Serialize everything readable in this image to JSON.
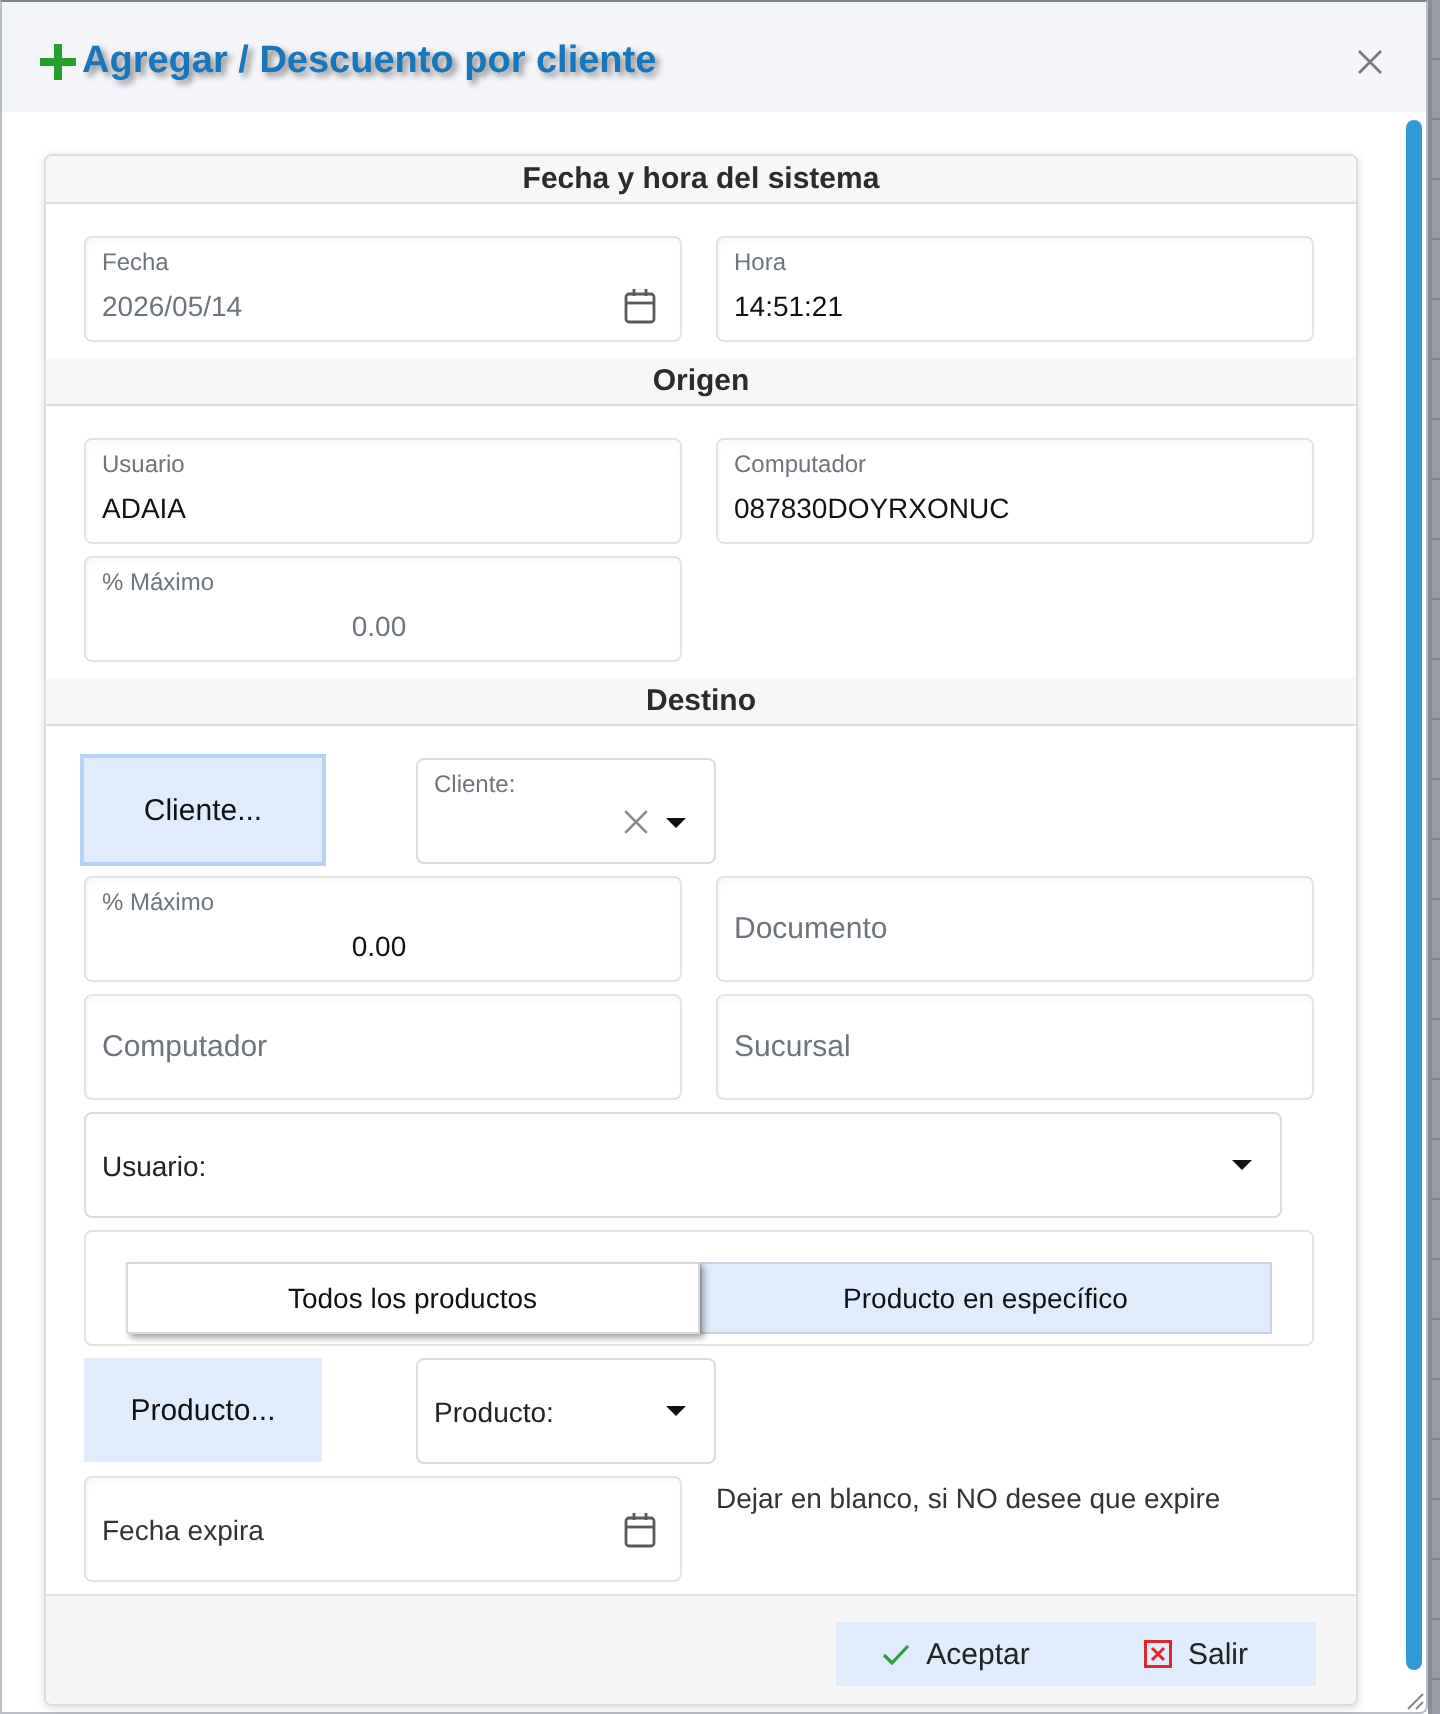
{
  "dialog": {
    "title": "Agregar / Descuento por cliente"
  },
  "sections": [
    {
      "title": "Fecha y hora del sistema",
      "items": [
        {
          "kind": "date",
          "label": "Fecha",
          "value": "2026/05/14",
          "disabled": true
        },
        {
          "kind": "text",
          "label": "Hora",
          "value": "14:51:21",
          "disabled": false
        }
      ]
    },
    {
      "title": "Origen",
      "items": [
        {
          "kind": "text",
          "label": "Usuario",
          "value": "ADAIA",
          "disabled": false
        },
        {
          "kind": "text",
          "label": "Computador",
          "value": "087830DOYRXONUC",
          "disabled": false
        },
        {
          "kind": "number",
          "label": "% Máximo",
          "value": "0.00",
          "disabled": true
        }
      ]
    },
    {
      "title": "Destino",
      "items": [
        {
          "kind": "lookup",
          "button": "Cliente...",
          "focused": true,
          "select": {
            "label": "Cliente:",
            "clearable": true
          }
        },
        {
          "kind": "number",
          "label": "% Máximo",
          "value": "0.00",
          "disabled": false
        },
        {
          "kind": "text",
          "placeholder": "Documento",
          "disabled": false
        },
        {
          "kind": "text",
          "placeholder": "Computador",
          "disabled": false
        },
        {
          "kind": "text",
          "placeholder": "Sucursal",
          "disabled": false
        },
        {
          "kind": "select",
          "placeholder": "Usuario:"
        },
        {
          "kind": "toggle",
          "options": [
            {
              "label": "Todos los productos",
              "selected": false
            },
            {
              "label": "Producto en específico",
              "selected": true
            }
          ]
        },
        {
          "kind": "lookup",
          "button": "Producto...",
          "focused": false,
          "select": {
            "placeholder": "Producto:",
            "clearable": false
          }
        },
        {
          "kind": "date",
          "placeholder": "Fecha expira",
          "disabled": false
        },
        {
          "kind": "note",
          "text": "Dejar en blanco, si NO desee que expire"
        }
      ]
    }
  ],
  "footer": {
    "buttons": [
      {
        "kind": "accept",
        "label": "Aceptar"
      },
      {
        "kind": "exit",
        "label": "Salir"
      }
    ]
  }
}
